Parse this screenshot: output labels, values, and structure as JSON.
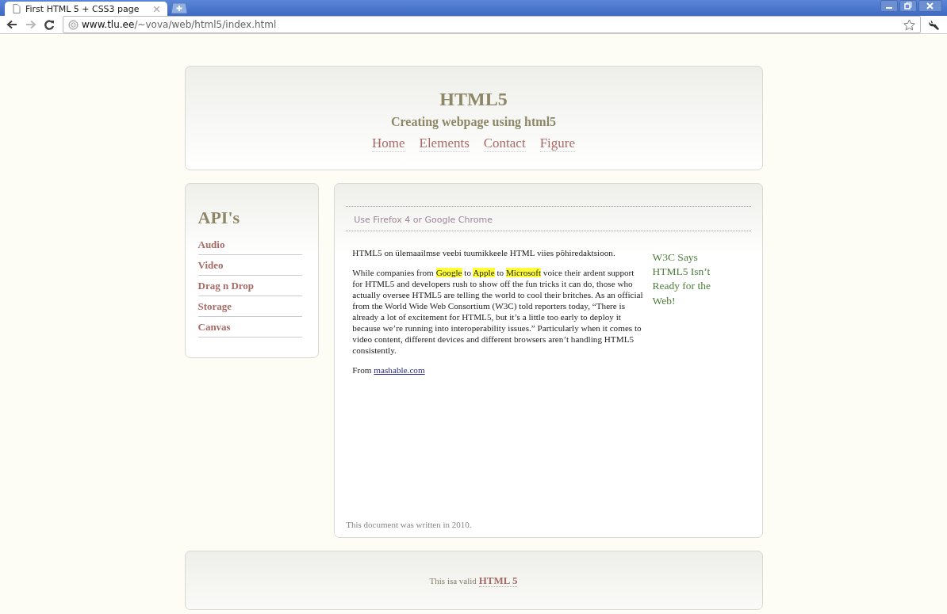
{
  "browser": {
    "tab": {
      "title": "First HTML 5 + CSS3 page",
      "selected": true
    },
    "address": {
      "host": "www.tlu.ee",
      "path": "/~vova/web/html5/index.html"
    }
  },
  "header": {
    "title": "HTML5",
    "subtitle": "Creating webpage using html5",
    "nav": [
      "Home",
      "Elements",
      "Contact",
      "Figure"
    ]
  },
  "sidebar": {
    "title": "API's",
    "items": [
      "Audio",
      "Video",
      "Drag n Drop",
      "Storage",
      "Canvas"
    ]
  },
  "main": {
    "notice": "Use Firefox 4 or Google Chrome",
    "aside": "W3C Says HTML5 Isn’t Ready for the Web!",
    "intro": "HTML5 on ülemaailmse veebi tuumikkeele HTML viies põhiredaktsioon.",
    "article": [
      {
        "text": "While companies from ",
        "highlighted": false
      },
      {
        "text": "Google",
        "highlighted": true
      },
      {
        "text": " to ",
        "highlighted": false
      },
      {
        "text": "Apple",
        "highlighted": true
      },
      {
        "text": " to ",
        "highlighted": false
      },
      {
        "text": "Microsoft",
        "highlighted": true
      },
      {
        "text": " voice their ardent support for HTML5 and developers rush to show off the fun tricks it can do, those who actually oversee HTML5 are telling the world to cool their britches. As an official from the World Wide Web Consortium (W3C) told reporters today, “There is already a lot of excitement for HTML5, but it’s a little too early to deploy it because we’re running into interoperability issues.” Particularly when it comes to video content, different devices and different browsers aren’t handling HTML5 consistently.",
        "highlighted": false
      }
    ],
    "source": {
      "prefix": "From ",
      "link": "mashable.com"
    },
    "footnote": "This document was written in 2010."
  },
  "footer": {
    "prefix": "This isa valid ",
    "link": "HTML 5"
  }
}
